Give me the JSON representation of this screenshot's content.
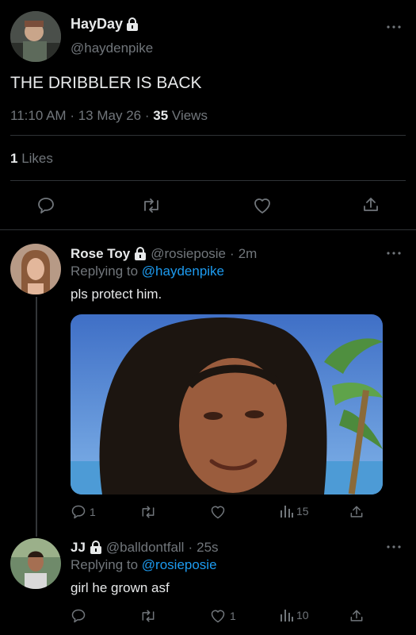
{
  "main_tweet": {
    "display_name": "HayDay",
    "handle": "@haydenpike",
    "text": "THE DRIBBLER IS BACK",
    "time": "11:10 AM",
    "date": "13 May 26",
    "views_count": "35",
    "views_label": "Views",
    "likes_count": "1",
    "likes_label": "Likes",
    "sep": "·"
  },
  "reply1": {
    "display_name": "Rose Toy",
    "handle": "@rosieposie",
    "age": "2m",
    "replying_prefix": "Replying to",
    "replying_handle": "@haydenpike",
    "text": "pls protect him.",
    "reply_count": "1",
    "views_count": "15",
    "sep": "·"
  },
  "reply2": {
    "display_name": "JJ",
    "handle": "@balldontfall",
    "age": "25s",
    "replying_prefix": "Replying to",
    "replying_handle": "@rosieposie",
    "text": "girl he grown asf",
    "like_count": "1",
    "views_count": "10",
    "sep": "·"
  },
  "colors": {
    "background": "#000000",
    "text": "#e7e9ea",
    "muted": "#71767b",
    "link": "#1d9bf0",
    "divider": "#2f3336"
  },
  "icons": [
    "more-icon",
    "lock-icon",
    "reply-icon",
    "retweet-icon",
    "like-icon",
    "share-icon",
    "views-icon"
  ]
}
